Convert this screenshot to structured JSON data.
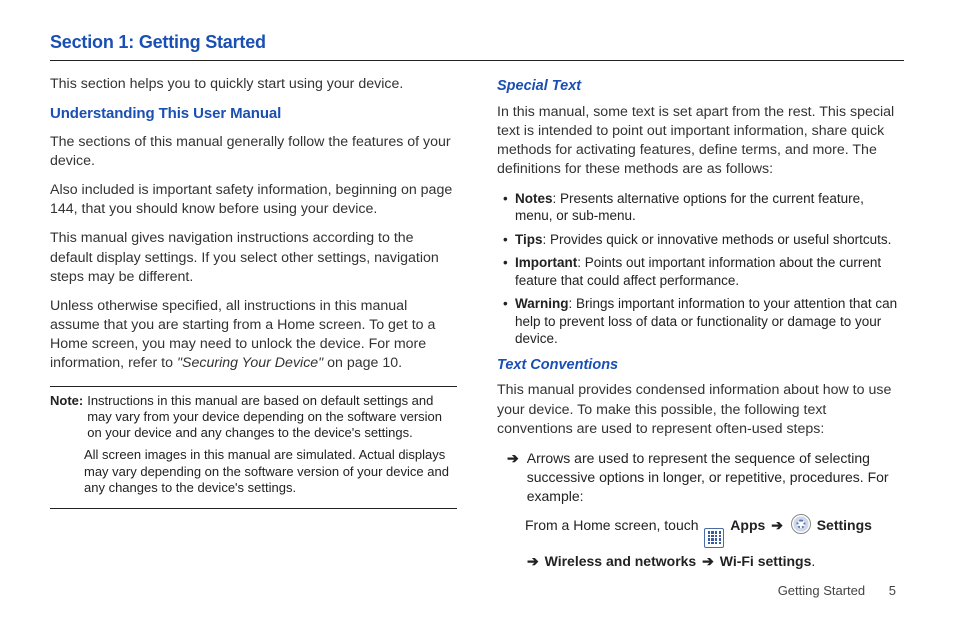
{
  "section_title": "Section 1: Getting Started",
  "left": {
    "intro": "This section helps you to quickly start using your device.",
    "heading": "Understanding This User Manual",
    "p1": "The sections of this manual generally follow the features of your device.",
    "p2": "Also included is important safety information, beginning on page 144, that you should know before using your device.",
    "p3": "This manual gives navigation instructions according to the default display settings. If you select other settings, navigation steps may be different.",
    "p4a": "Unless otherwise specified, all instructions in this manual assume that you are starting from a Home screen. To get to a Home screen, you may need to unlock the device. For more information, refer to ",
    "p4b": "\"Securing Your Device\" ",
    "p4c": " on page 10.",
    "note_label": "Note:",
    "note_text1": "Instructions in this manual are based on default settings and may vary from your device depending on the software version on your device and any changes to the device's settings.",
    "note_text2": "All screen images in this manual are simulated. Actual displays may vary depending on the software version of your device and any changes to the device's settings."
  },
  "right": {
    "h1": "Special Text",
    "p1": "In this manual, some text is set apart from the rest. This special text is intended to point out important information, share quick methods for activating features, define terms, and more. The definitions for these methods are as follows:",
    "bullets": [
      {
        "label": "Notes",
        "text": ": Presents alternative options for the current feature, menu, or sub-menu."
      },
      {
        "label": "Tips",
        "text": ": Provides quick or innovative methods or useful shortcuts."
      },
      {
        "label": "Important",
        "text": ": Points out important information about the current feature that could affect performance."
      },
      {
        "label": "Warning",
        "text": ": Brings important information to your attention that can help to prevent loss of data or functionality or damage to your device."
      }
    ],
    "h2": "Text Conventions",
    "p2": "This manual provides condensed information about how to use your device. To make this possible, the following text conventions are used to represent often-used steps:",
    "arrow_glyph": "➔",
    "arrow_text": "Arrows are used to represent the sequence of selecting successive options in longer, or repetitive, procedures. For example:",
    "example_prefix": "From a Home screen, touch ",
    "apps_label": "Apps",
    "settings_label": "Settings",
    "arrow_inline": "➔",
    "line2a": "Wireless and networks",
    "line2b": "Wi-Fi settings",
    "period": "."
  },
  "footer_label": "Getting Started",
  "page_number": "5"
}
